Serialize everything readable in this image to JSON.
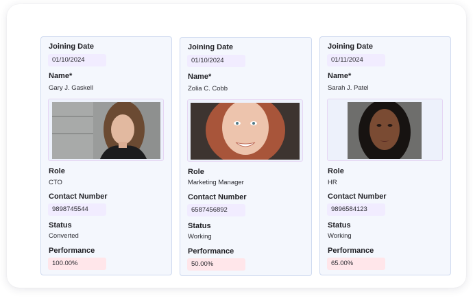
{
  "labels": {
    "joining_date": "Joining Date",
    "name": "Name*",
    "role": "Role",
    "contact": "Contact Number",
    "status": "Status",
    "performance": "Performance"
  },
  "employees": [
    {
      "joining_date": "01/10/2024",
      "name": "Gary J. Gaskell",
      "role": "CTO",
      "contact": "9898745544",
      "status": "Converted",
      "performance": "100.00%"
    },
    {
      "joining_date": "01/10/2024",
      "name": "Zolia C. Cobb",
      "role": "Marketing Manager",
      "contact": "6587456892",
      "status": "Working",
      "performance": "50.00%"
    },
    {
      "joining_date": "01/11/2024",
      "name": "Sarah J. Patel",
      "role": "HR",
      "contact": "9896584123",
      "status": "Working",
      "performance": "65.00%"
    }
  ],
  "colors": {
    "card_bg": "#f4f7fd",
    "card_border": "#cfdaf0",
    "pill_bg": "#f1ecff",
    "performance_pill_bg": "#ffe6ea"
  }
}
